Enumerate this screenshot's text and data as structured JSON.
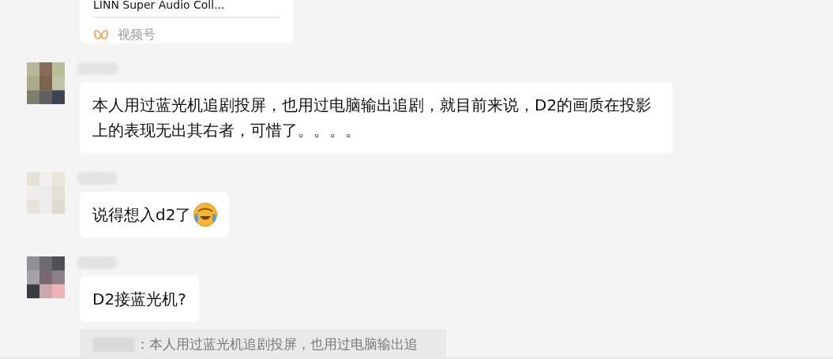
{
  "messages": [
    {
      "kind": "card",
      "title": "LINN Super Audio Coll...",
      "source": "视频号"
    },
    {
      "kind": "text",
      "text": "本人用过蓝光机追剧投屏，也用过电脑输出追剧，就目前来说，D2的画质在投影上的表现无出其右者，可惜了。。。。",
      "emoji": false
    },
    {
      "kind": "text",
      "text": "说得想入d2了",
      "emoji": true
    },
    {
      "kind": "text",
      "text": "D2接蓝光机?",
      "emoji": false,
      "quote": "：本人用过蓝光机追剧投屏，也用过电脑输出追"
    }
  ]
}
